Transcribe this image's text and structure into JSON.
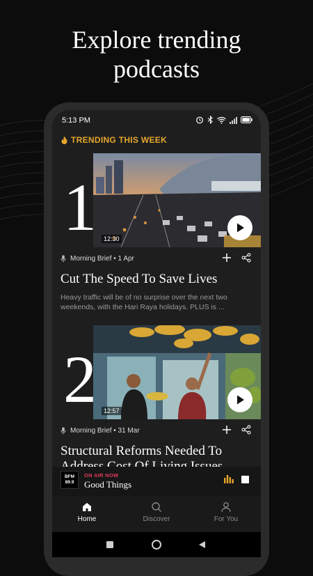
{
  "headline": "Explore trending podcasts",
  "status_bar": {
    "time": "5:13 PM",
    "icons": [
      "alarm-icon",
      "bluetooth-icon",
      "wifi-icon",
      "signal-icon",
      "battery-icon"
    ]
  },
  "section": {
    "title": "TRENDING THIS WEEK",
    "icon": "flame-icon",
    "accent": "#e6a72c"
  },
  "episodes": [
    {
      "rank": "1",
      "duration": "12:30",
      "show": "Morning Brief • 1 Apr",
      "title": "Cut The Speed To Save Lives",
      "description": "Heavy traffic will be of no surprise over the next two weekends, with the Hari Raya holidays. PLUS is ..."
    },
    {
      "rank": "2",
      "duration": "12:57",
      "show": "Morning Brief • 31 Mar",
      "title": "Structural Reforms Needed To Address Cost Of Living Issues",
      "description": ""
    }
  ],
  "player": {
    "station_logo": "BFM 89.9",
    "status": "ON AIR NOW",
    "show": "Good Things",
    "status_color": "#e23a5a"
  },
  "tabs": [
    {
      "label": "Home",
      "icon": "home-icon",
      "active": true
    },
    {
      "label": "Discover",
      "icon": "search-icon",
      "active": false
    },
    {
      "label": "For You",
      "icon": "user-icon",
      "active": false
    }
  ],
  "nav": [
    "square-icon",
    "circle-icon",
    "back-triangle-icon"
  ]
}
